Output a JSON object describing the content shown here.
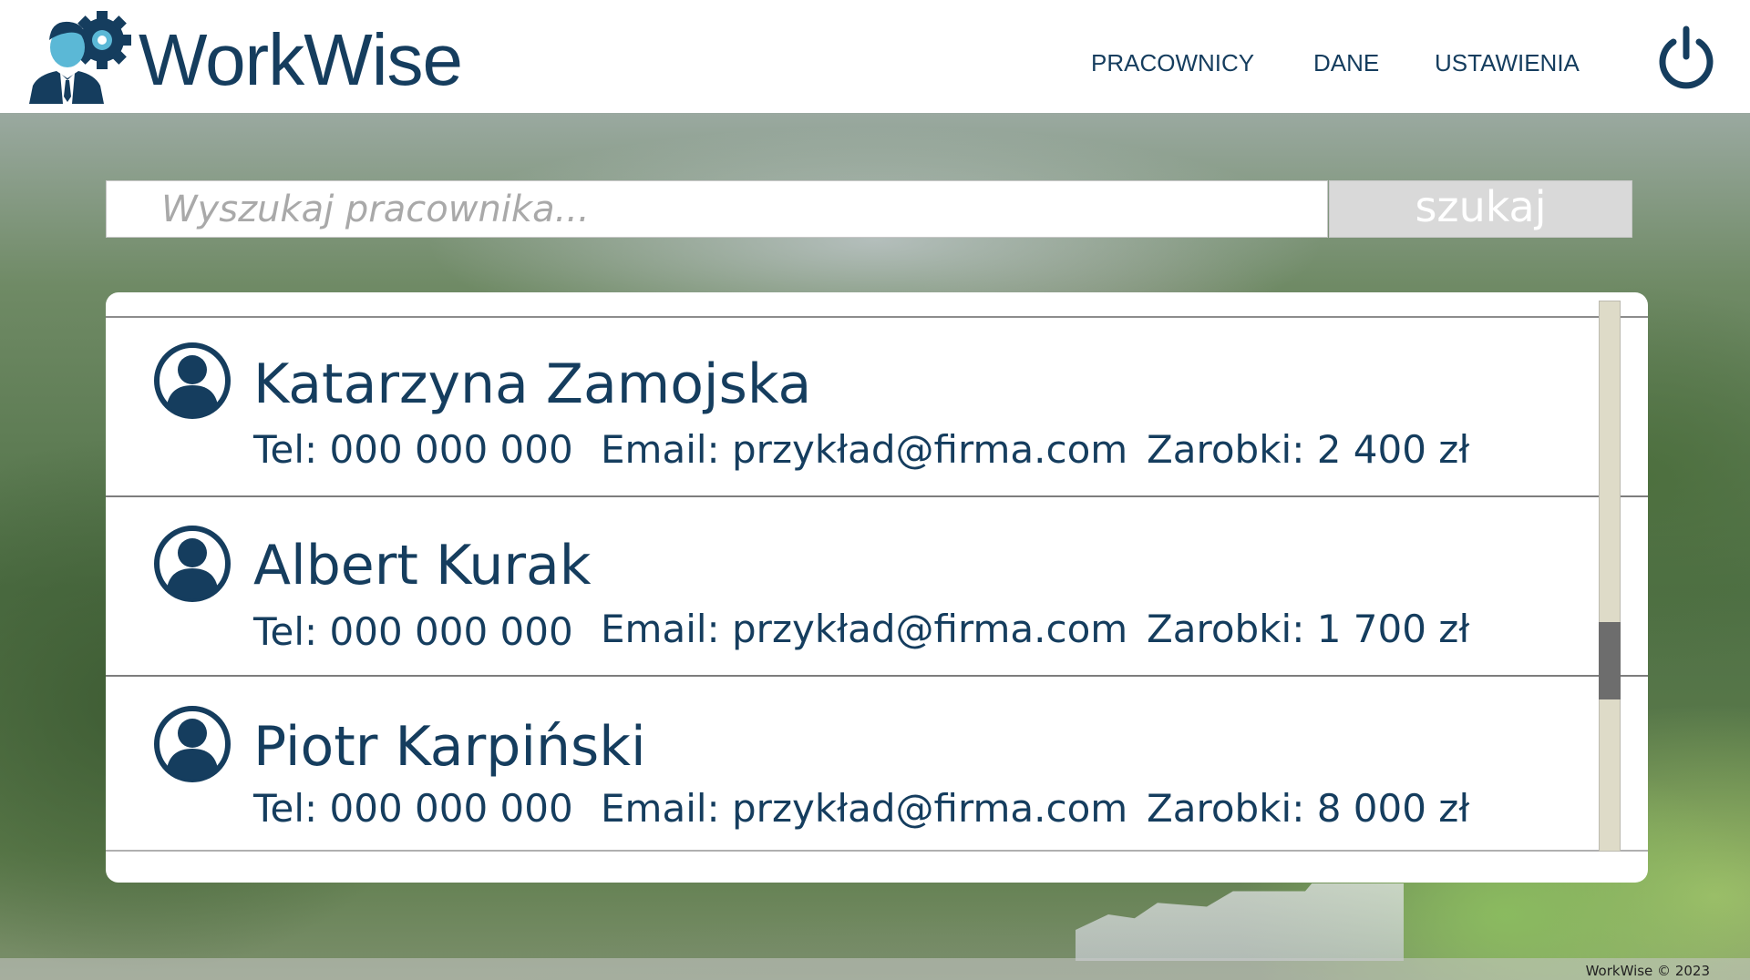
{
  "header": {
    "brand": "WorkWise",
    "nav": [
      "PRACOWNICY",
      "DANE",
      "USTAWIENIA"
    ],
    "power_icon": "power-icon"
  },
  "search": {
    "placeholder": "Wyszukaj pracownika...",
    "button_label": "szukaj"
  },
  "employees": [
    {
      "name": "Katarzyna Zamojska",
      "tel": "Tel: 000 000 000",
      "email": "Email: przykład@firma.com",
      "salary": "Zarobki: 2 400 zł"
    },
    {
      "name": "Albert Kurak",
      "tel": "Tel: 000 000 000",
      "email": "Email: przykład@firma.com",
      "salary": "Zarobki: 1 700 zł"
    },
    {
      "name": "Piotr Karpiński",
      "tel": "Tel: 000 000 000",
      "email": "Email: przykład@firma.com",
      "salary": "Zarobki: 8 000 zł"
    }
  ],
  "footer": {
    "copyright": "WorkWise © 2023"
  },
  "colors": {
    "primary": "#153d5e",
    "accent": "#5bb8d6",
    "button_bg": "#d9d9d9"
  }
}
